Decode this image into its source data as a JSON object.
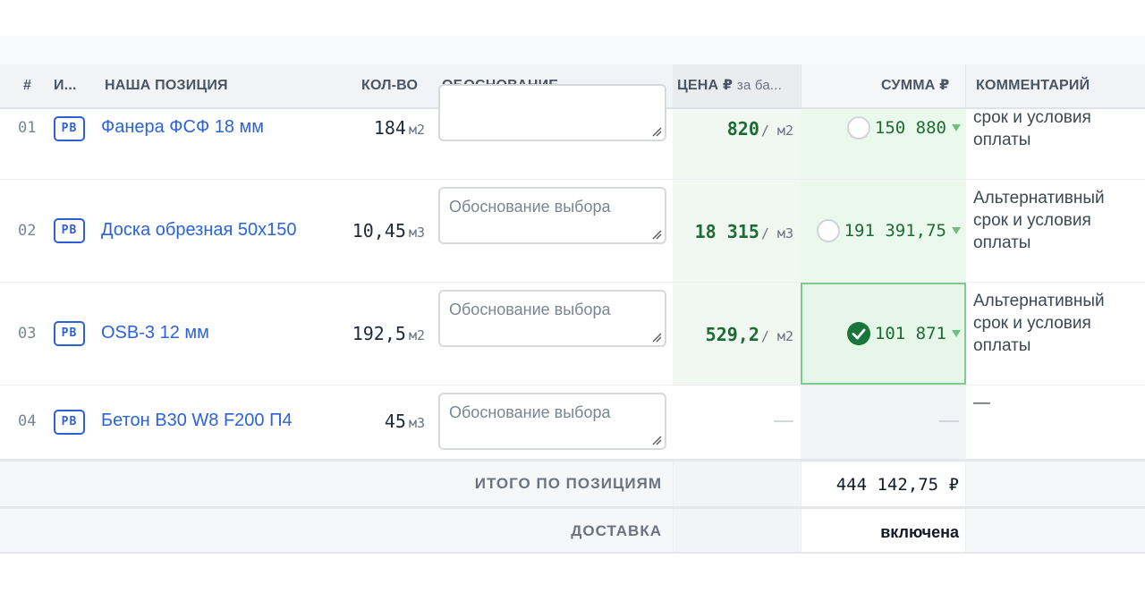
{
  "header": {
    "num": "#",
    "icon_col": "И...",
    "position": "НАША ПОЗИЦИЯ",
    "qty": "КОЛ-ВО",
    "reason": "ОБОСНОВАНИЕ",
    "price": "ЦЕНА ₽",
    "price_sub": "за ба...",
    "sum": "СУММА ₽",
    "comment": "КОММЕНТАРИЙ"
  },
  "rows": [
    {
      "num": "01",
      "badge": "PB",
      "name": "Фанера ФСФ 18 мм",
      "qty": "184",
      "qty_unit": "м2",
      "reason_placeholder": "",
      "price": "820",
      "price_unit": "/ м2",
      "sum": "150 880",
      "selected": false,
      "comment_lines": [
        "срок и условия",
        "оплаты"
      ]
    },
    {
      "num": "02",
      "badge": "PB",
      "name": "Доска обрезная 50х150",
      "qty": "10,45",
      "qty_unit": "м3",
      "reason_placeholder": "Обоснование выбора",
      "price": "18 315",
      "price_unit": "/ м3",
      "sum": "191 391,75",
      "selected": false,
      "comment_lines": [
        "Альтернативный",
        "срок и условия",
        "оплаты"
      ]
    },
    {
      "num": "03",
      "badge": "PB",
      "name": "OSB-3 12 мм",
      "qty": "192,5",
      "qty_unit": "м2",
      "reason_placeholder": "Обоснование выбора",
      "price": "529,2",
      "price_unit": "/ м2",
      "sum": "101 871",
      "selected": true,
      "comment_lines": [
        "Альтернативный",
        "срок и условия",
        "оплаты"
      ]
    },
    {
      "num": "04",
      "badge": "PB",
      "name": "Бетон В30 W8 F200 П4",
      "qty": "45",
      "qty_unit": "м3",
      "reason_placeholder": "Обоснование выбора",
      "price": "",
      "sum": "",
      "selected": false,
      "comment_lines": [
        "—"
      ]
    }
  ],
  "totals": {
    "items_label": "ИТОГО ПО ПОЗИЦИЯМ",
    "items_value": "444 142,75 ₽",
    "delivery_label": "ДОСТАВКА",
    "delivery_value": "включена"
  }
}
